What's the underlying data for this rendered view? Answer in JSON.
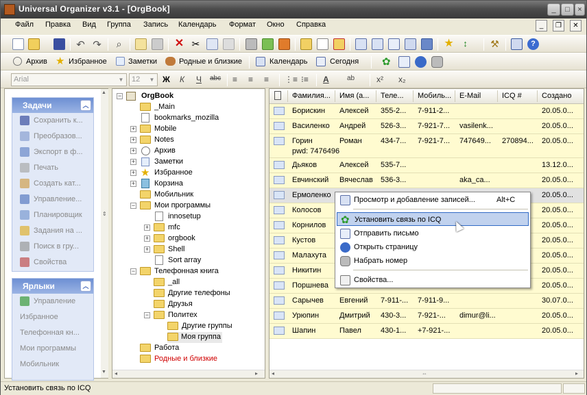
{
  "window": {
    "title": "Universal Organizer v3.1 - [OrgBook]"
  },
  "menu": [
    "Файл",
    "Правка",
    "Вид",
    "Группа",
    "Запись",
    "Календарь",
    "Формат",
    "Окно",
    "Справка"
  ],
  "toolbar2": {
    "items": [
      "Архив",
      "Избранное",
      "Заметки",
      "Родные и близкие",
      "Календарь",
      "Сегодня"
    ]
  },
  "format_bar": {
    "font_placeholder": "Arial",
    "size_placeholder": "12",
    "bold": "Ж",
    "italic": "К",
    "underline": "Ч",
    "strike": "abc",
    "superscript": "x²",
    "subscript": "x₂"
  },
  "tasks_panel": {
    "title": "Задачи",
    "items": [
      "Сохранить к...",
      "Преобразов...",
      "Экспорт в ф...",
      "Печать",
      "Создать кат...",
      "Управление...",
      "Планировщик",
      "Задания на ...",
      "Поиск в гру...",
      "Свойства"
    ]
  },
  "shortcuts_panel": {
    "title": "Ярлыки",
    "items": [
      "Управление",
      "Избранное",
      "Телефонная кн...",
      "Мои программы",
      "Мобильник"
    ]
  },
  "tree": {
    "root": "OrgBook",
    "nodes": [
      "_Main",
      "bookmarks_mozilla",
      "Mobile",
      "Notes",
      "Архив",
      "Заметки",
      "Избранное",
      "Корзина",
      "Мобильник",
      "Мои программы",
      "innosetup",
      "mfc",
      "orgbook",
      "Shell",
      "Sort array",
      "Телефонная книга",
      "_all",
      "Другие телефоны",
      "Друзья",
      "Политех",
      "Другие группы",
      "Моя группа",
      "Работа",
      "Родные и близкие"
    ]
  },
  "list": {
    "columns": [
      "Фамилия...",
      "Имя (а...",
      "Теле...",
      "Мобиль...",
      "E-Mail",
      "ICQ #",
      "Создано"
    ],
    "rows": [
      [
        "Борискин",
        "Алексей",
        "355-2...",
        "7-911-2...",
        "",
        "",
        "20.05.0..."
      ],
      [
        "Василенко",
        "Андрей",
        "526-3...",
        "7-921-7...",
        "vasilenk...",
        "",
        "20.05.0..."
      ],
      [
        "Горин",
        "Роман",
        "434-7...",
        "7-921-7...",
        "747649...",
        "270894...",
        "20.05.0..."
      ],
      [
        "Дьяков",
        "Алексей",
        "535-7...",
        "",
        "",
        "",
        "13.12.0..."
      ],
      [
        "Евчинский",
        "Вячеслав",
        "536-3...",
        "",
        "aka_ca...",
        "",
        "20.05.0..."
      ],
      [
        "Ермоленко",
        "",
        "",
        "",
        "",
        "",
        "20.05.0..."
      ],
      [
        "Колосов",
        "",
        "",
        "",
        "",
        "",
        "20.05.0..."
      ],
      [
        "Корнилов",
        "",
        "",
        "",
        "",
        "",
        "20.05.0..."
      ],
      [
        "Кустов",
        "",
        "",
        "",
        "",
        "",
        "20.05.0..."
      ],
      [
        "Малахута",
        "",
        "",
        "",
        "",
        "",
        "20.05.0..."
      ],
      [
        "Никитин",
        "",
        "",
        "",
        "",
        "",
        "20.05.0..."
      ],
      [
        "Поршнева",
        "",
        "",
        "",
        "",
        "",
        "20.05.0..."
      ],
      [
        "Сарычев",
        "Евгений",
        "7-911-...",
        "7-911-9...",
        "",
        "",
        "30.07.0..."
      ],
      [
        "Урюпин",
        "Дмитрий",
        "430-3...",
        "7-921-...",
        "dimur@li...",
        "",
        "20.05.0..."
      ],
      [
        "Шапин",
        "Павел",
        "430-1...",
        "+7-921-...",
        "",
        "",
        "20.05.0..."
      ]
    ],
    "extra_line": "pwd: 7476496"
  },
  "context_menu": {
    "items": [
      {
        "label": "Просмотр и добавление записей...",
        "shortcut": "Alt+C"
      },
      {
        "label": "Установить связь по ICQ",
        "shortcut": ""
      },
      {
        "label": "Отправить письмо",
        "shortcut": ""
      },
      {
        "label": "Открыть страницу",
        "shortcut": ""
      },
      {
        "label": "Набрать номер",
        "shortcut": ""
      },
      {
        "label": "Свойства...",
        "shortcut": ""
      }
    ]
  },
  "status": {
    "text": "Установить связь по ICQ"
  }
}
